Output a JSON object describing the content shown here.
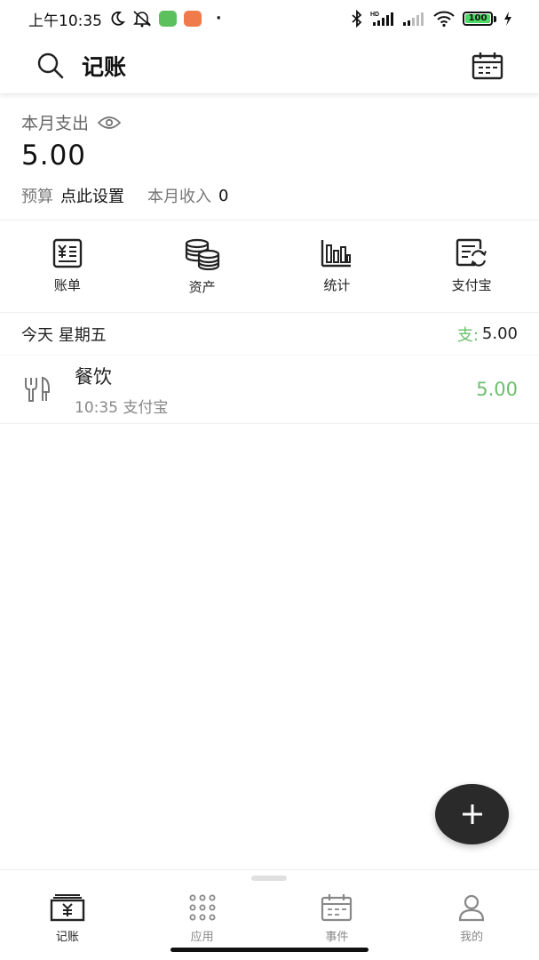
{
  "status_bar": {
    "time": "上午10:35",
    "battery": "100",
    "dot": "·",
    "icons": [
      "moon-icon",
      "bell-muted-icon",
      "green-app-icon",
      "orange-app-icon",
      "bluetooth-icon",
      "signal-hd-icon",
      "signal-icon",
      "wifi-icon",
      "battery-icon",
      "charging-icon"
    ]
  },
  "header": {
    "title": "记账",
    "icons": [
      "search-icon",
      "calendar-icon"
    ]
  },
  "summary": {
    "label": "本月支出",
    "amount": "5.00",
    "budget_label": "预算",
    "budget_action": "点此设置",
    "income_label": "本月收入",
    "income_value": "0"
  },
  "quick_actions": [
    {
      "label": "账单",
      "icon": "bill-icon"
    },
    {
      "label": "资产",
      "icon": "coins-icon"
    },
    {
      "label": "统计",
      "icon": "bar-chart-icon"
    },
    {
      "label": "支付宝",
      "icon": "alipay-sync-icon"
    }
  ],
  "day": {
    "label": "今天 星期五",
    "expense_prefix": "支:",
    "expense_value": "5.00"
  },
  "records": [
    {
      "category": "餐饮",
      "time_account": "10:35 支付宝",
      "amount": "5.00",
      "icon": "fork-knife-icon"
    }
  ],
  "bottom_nav": [
    {
      "label": "记账",
      "icon": "ledger-icon",
      "active": true
    },
    {
      "label": "应用",
      "icon": "apps-grid-icon",
      "active": false
    },
    {
      "label": "事件",
      "icon": "calendar-icon",
      "active": false
    },
    {
      "label": "我的",
      "icon": "person-icon",
      "active": false
    }
  ],
  "colors": {
    "accent_green": "#6cbf6c",
    "fab_bg": "#2a2a2a",
    "text_dark": "#111111",
    "text_muted": "#777777"
  }
}
